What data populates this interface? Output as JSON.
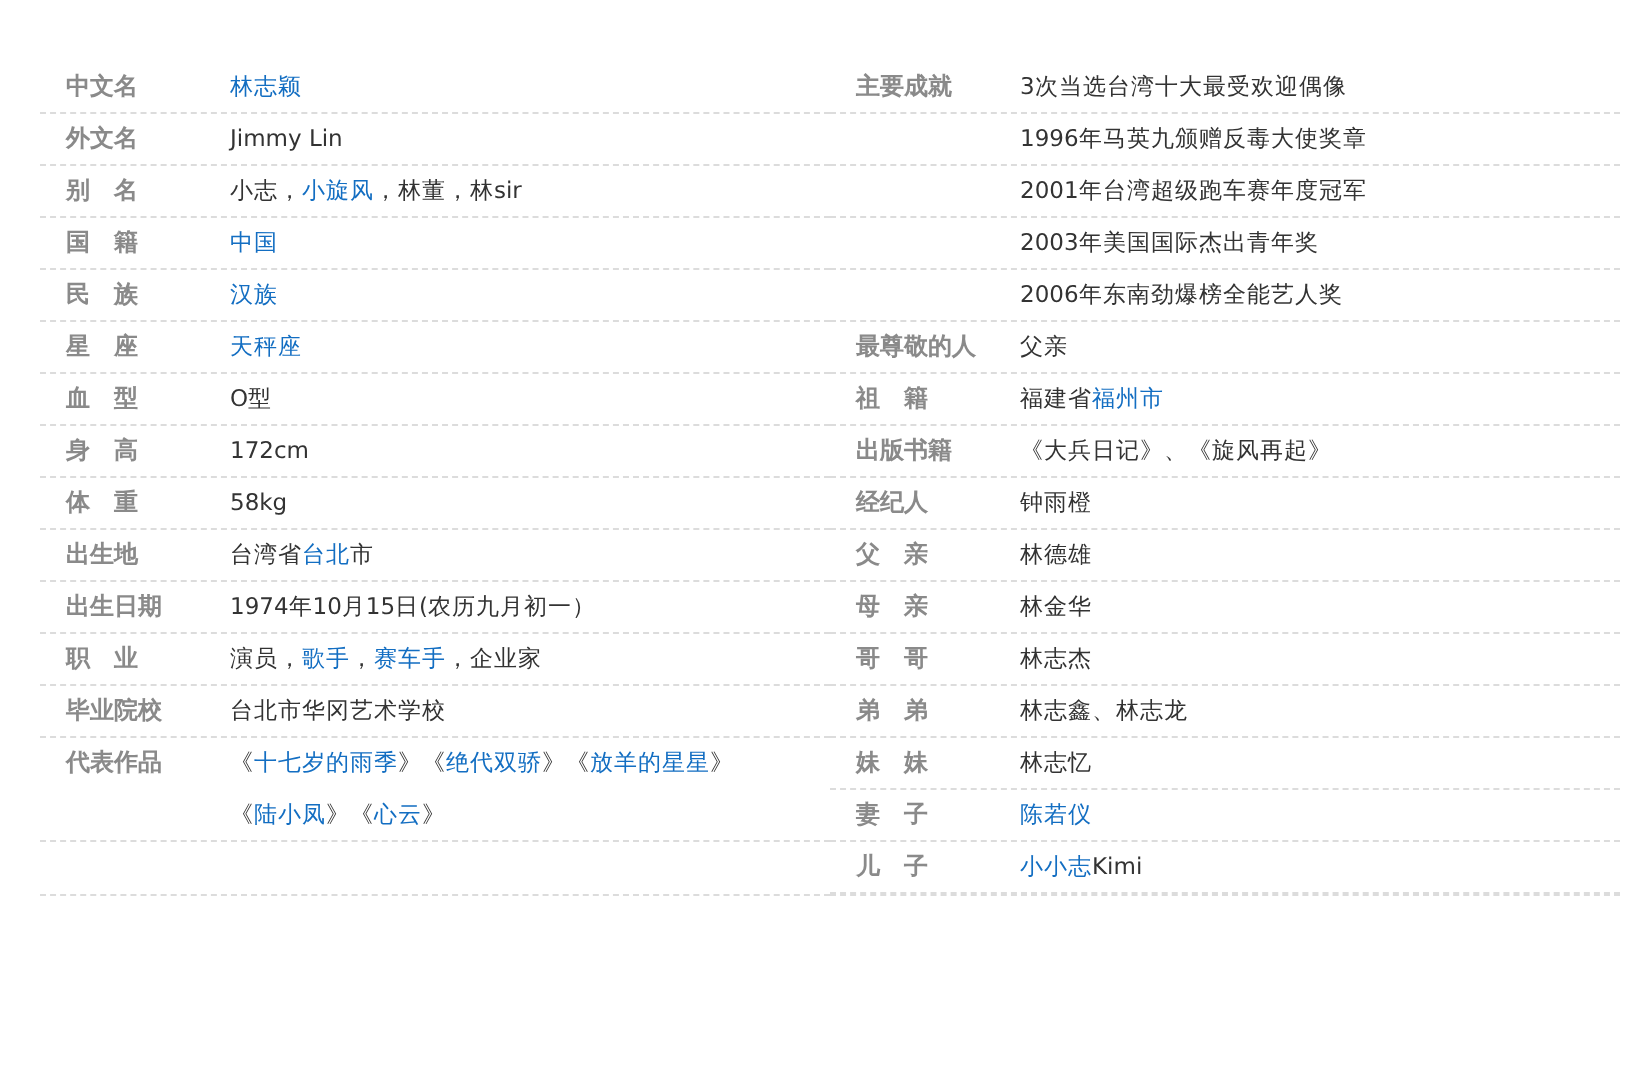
{
  "columns": [
    {
      "rows": [
        {
          "label": "中文名",
          "value": [
            {
              "text": "林志颖",
              "link": true
            }
          ]
        },
        {
          "label": "外文名",
          "value": [
            {
              "text": "Jimmy Lin",
              "link": false
            }
          ]
        },
        {
          "label": "别　名",
          "value": [
            {
              "text": "小志，",
              "link": false
            },
            {
              "text": "小旋风",
              "link": true
            },
            {
              "text": "，林董，林sir",
              "link": false
            }
          ]
        },
        {
          "label": "国　籍",
          "value": [
            {
              "text": "中国",
              "link": true
            }
          ]
        },
        {
          "label": "民　族",
          "value": [
            {
              "text": "汉族",
              "link": true
            }
          ]
        },
        {
          "label": "星　座",
          "value": [
            {
              "text": "天秤座",
              "link": true
            }
          ]
        },
        {
          "label": "血　型",
          "value": [
            {
              "text": "O型",
              "link": false
            }
          ]
        },
        {
          "label": "身　高",
          "value": [
            {
              "text": "172cm",
              "link": false
            }
          ]
        },
        {
          "label": "体　重",
          "value": [
            {
              "text": "58kg",
              "link": false
            }
          ]
        },
        {
          "label": "出生地",
          "value": [
            {
              "text": "台湾省",
              "link": false
            },
            {
              "text": "台北",
              "link": true
            },
            {
              "text": "市",
              "link": false
            }
          ]
        },
        {
          "label": "出生日期",
          "value": [
            {
              "text": "1974年10月15日(农历九月初一）",
              "link": false
            }
          ]
        },
        {
          "label": "职　业",
          "value": [
            {
              "text": "演员，",
              "link": false
            },
            {
              "text": "歌手",
              "link": true
            },
            {
              "text": "，",
              "link": false
            },
            {
              "text": "赛车手",
              "link": true
            },
            {
              "text": "，企业家",
              "link": false
            }
          ]
        },
        {
          "label": "毕业院校",
          "value": [
            {
              "text": "台北市华冈艺术学校",
              "link": false
            }
          ]
        },
        {
          "label": "代表作品",
          "value": [
            {
              "text": "《",
              "link": false
            },
            {
              "text": "十七岁的雨季",
              "link": true
            },
            {
              "text": "》《",
              "link": false
            },
            {
              "text": "绝代双骄",
              "link": true
            },
            {
              "text": "》《",
              "link": false
            },
            {
              "text": "放羊的星星",
              "link": true
            },
            {
              "text": "》《",
              "link": false
            },
            {
              "text": "陆小凤",
              "link": true
            },
            {
              "text": "》《",
              "link": false
            },
            {
              "text": "心云",
              "link": true
            },
            {
              "text": "》",
              "link": false
            }
          ]
        }
      ]
    },
    {
      "rows": [
        {
          "label": "主要成就",
          "value": [
            {
              "text": "3次当选台湾十大最受欢迎偶像",
              "link": false
            }
          ]
        },
        {
          "value": [
            {
              "text": "1996年马英九颁赠反毒大使奖章",
              "link": false
            }
          ]
        },
        {
          "value": [
            {
              "text": "2001年台湾超级跑车赛年度冠军",
              "link": false
            }
          ]
        },
        {
          "value": [
            {
              "text": "2003年美国国际杰出青年奖",
              "link": false
            }
          ]
        },
        {
          "value": [
            {
              "text": "2006年东南劲爆榜全能艺人奖",
              "link": false
            }
          ]
        },
        {
          "label": "最尊敬的人",
          "value": [
            {
              "text": "父亲",
              "link": false
            }
          ]
        },
        {
          "label": "祖　籍",
          "value": [
            {
              "text": "福建省",
              "link": false
            },
            {
              "text": "福州市",
              "link": true
            }
          ]
        },
        {
          "label": "出版书籍",
          "value": [
            {
              "text": "《大兵日记》、《旋风再起》",
              "link": false
            }
          ]
        },
        {
          "label": "经纪人",
          "value": [
            {
              "text": "钟雨橙",
              "link": false
            }
          ]
        },
        {
          "label": "父　亲",
          "value": [
            {
              "text": "林德雄",
              "link": false
            }
          ]
        },
        {
          "label": "母　亲",
          "value": [
            {
              "text": "林金华",
              "link": false
            }
          ]
        },
        {
          "label": "哥　哥",
          "value": [
            {
              "text": "林志杰",
              "link": false
            }
          ]
        },
        {
          "label": "弟　弟",
          "value": [
            {
              "text": "林志鑫、林志龙",
              "link": false
            }
          ]
        },
        {
          "label": "妹　妹",
          "value": [
            {
              "text": "林志忆",
              "link": false
            }
          ]
        },
        {
          "label": "妻　子",
          "value": [
            {
              "text": "陈若仪",
              "link": true
            }
          ]
        },
        {
          "label": "儿　子",
          "value": [
            {
              "text": "小小志",
              "link": true
            },
            {
              "text": "Kimi",
              "link": false
            }
          ]
        }
      ]
    }
  ]
}
